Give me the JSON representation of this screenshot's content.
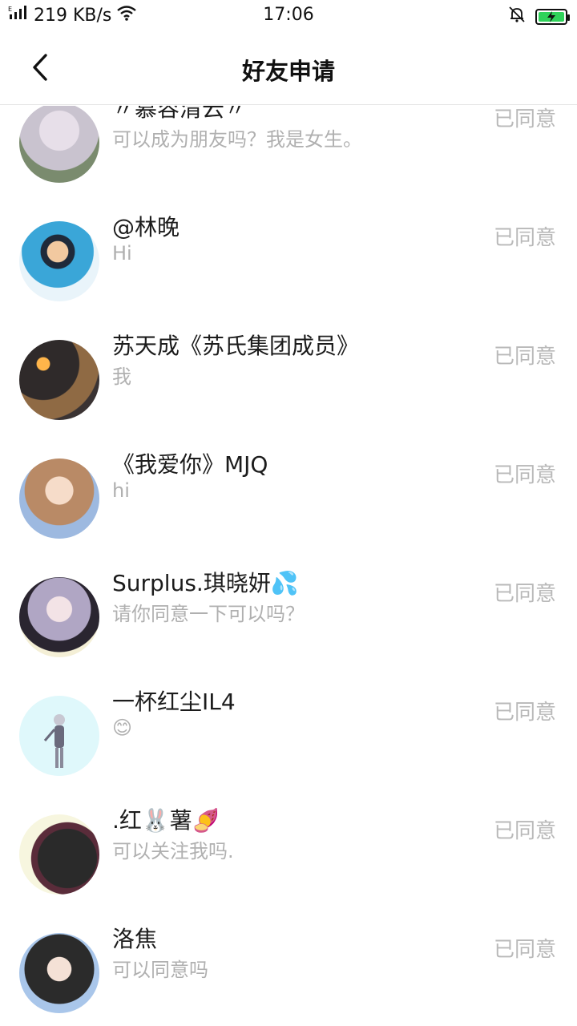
{
  "status_bar": {
    "signal_text": "E.ıl",
    "speed": "219 KB/s",
    "time": "17:06"
  },
  "nav": {
    "title": "好友申请"
  },
  "requests": [
    {
      "name": "〃慕容清云〃",
      "message": "可以成为朋友吗？我是女生。",
      "status": "已同意",
      "avatar_colors": [
        "#c9c3cf",
        "#7a8b6e"
      ]
    },
    {
      "name": "@林晚",
      "message": "Hi",
      "status": "已同意",
      "avatar_colors": [
        "#e9f4fa",
        "#3aa6d8"
      ]
    },
    {
      "name": "苏天成《苏氏集团成员》",
      "message": "我",
      "status": "已同意",
      "avatar_colors": [
        "#2f2a2a",
        "#c08a4d"
      ]
    },
    {
      "name": "《我爱你》MJQ",
      "message": "hi",
      "status": "已同意",
      "avatar_colors": [
        "#9db9e0",
        "#c89a7a"
      ]
    },
    {
      "name": "Surplus.琪晓妍💦",
      "message": "请你同意一下可以吗？",
      "status": "已同意",
      "avatar_colors": [
        "#f4efd6",
        "#b0a6c4"
      ]
    },
    {
      "name": "一杯红尘IL4",
      "message": "😊",
      "status": "已同意",
      "avatar_colors": [
        "#dff8fb",
        "#7a7a8a"
      ]
    },
    {
      "name": ".红🐰薯🍠",
      "message": "可以关注我吗.",
      "status": "已同意",
      "avatar_colors": [
        "#f7f6df",
        "#2a2a2a"
      ]
    },
    {
      "name": "洛焦",
      "message": "可以同意吗",
      "status": "已同意",
      "avatar_colors": [
        "#a9c6ea",
        "#2b2b2b"
      ]
    }
  ]
}
